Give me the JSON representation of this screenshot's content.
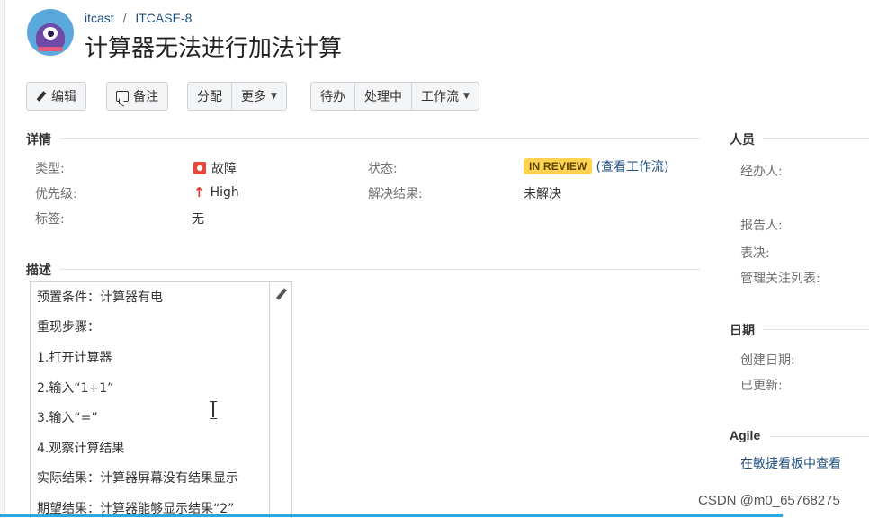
{
  "header": {
    "project": "itcast",
    "separator": "/",
    "issue_key": "ITCASE-8",
    "title": "计算器无法进行加法计算"
  },
  "toolbar": {
    "edit": "编辑",
    "comment": "备注",
    "assign": "分配",
    "more": "更多",
    "todo": "待办",
    "in_progress": "处理中",
    "workflow": "工作流"
  },
  "details": {
    "heading": "详情",
    "type_label": "类型:",
    "type_value": "故障",
    "priority_label": "优先级:",
    "priority_value": "High",
    "labels_label": "标签:",
    "labels_value": "无",
    "status_label": "状态:",
    "status_value": "IN REVIEW",
    "view_workflow": "(查看工作流)",
    "resolution_label": "解决结果:",
    "resolution_value": "未解决"
  },
  "description": {
    "heading": "描述",
    "lines": [
      "预置条件：计算器有电",
      "重现步骤：",
      "1.打开计算器",
      "2.输入“1+1”",
      "3.输入“=”",
      "4.观察计算结果",
      "实际结果：计算器屏幕没有结果显示",
      "期望结果：计算器能够显示结果“2”"
    ]
  },
  "people": {
    "heading": "人员",
    "assignee_label": "经办人:",
    "reporter_label": "报告人:",
    "votes_label": "表决:",
    "watchers_label": "管理关注列表:"
  },
  "dates": {
    "heading": "日期",
    "created_label": "创建日期:",
    "updated_label": "已更新:"
  },
  "agile": {
    "heading": "Agile",
    "view_on_board": "在敏捷看板中查看"
  },
  "watermark": "CSDN @m0_65768275",
  "colors": {
    "status_badge": "#ffd351",
    "link": "#205081",
    "bug": "#e5493a",
    "priority_high": "#d04437",
    "progress": "#2ea7e0"
  }
}
